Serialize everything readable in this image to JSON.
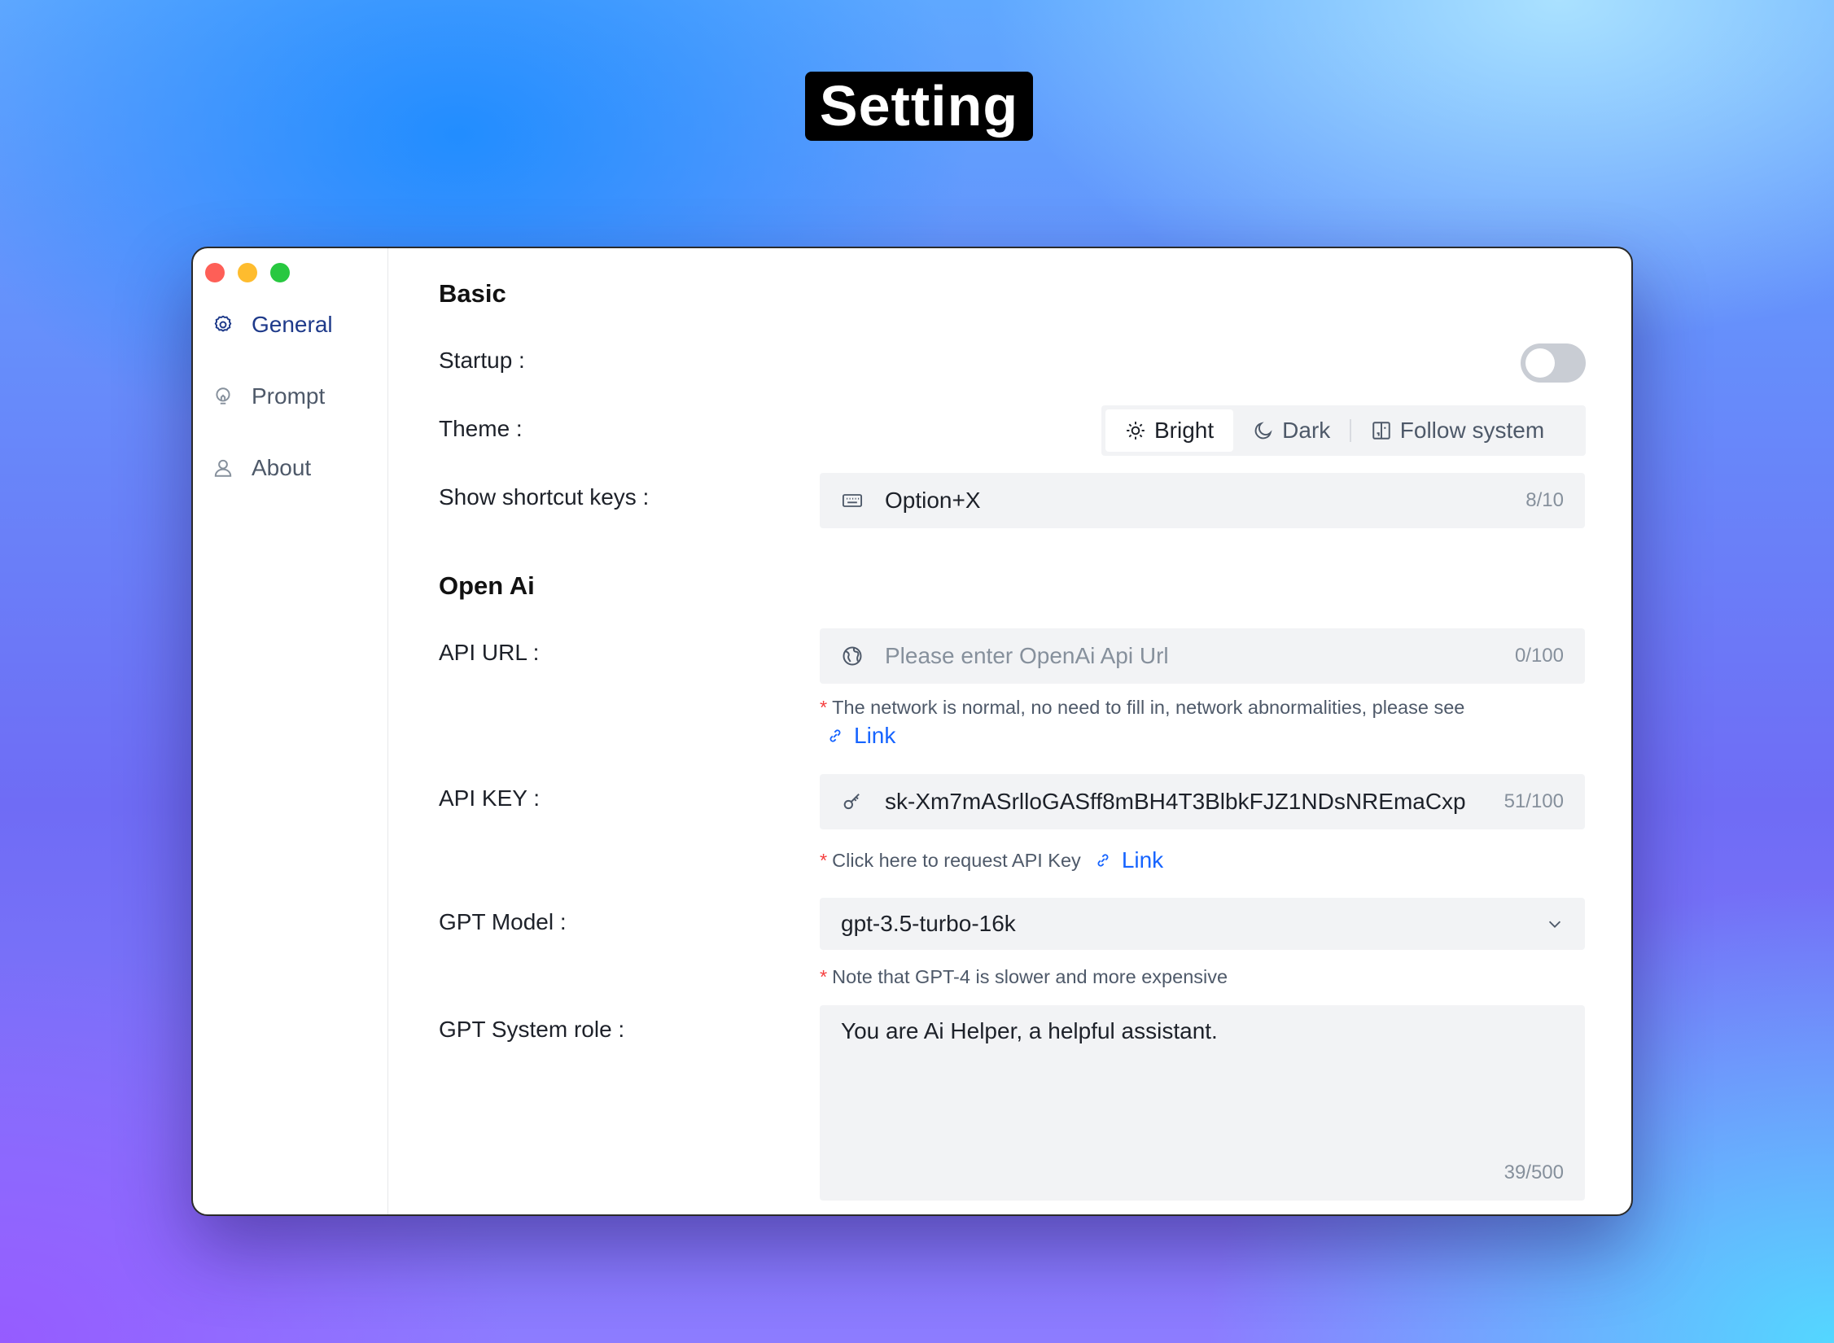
{
  "hero_title": "Setting",
  "sidebar": {
    "items": [
      {
        "label": "General",
        "icon": "gear-icon",
        "active": true
      },
      {
        "label": "Prompt",
        "icon": "bulb-icon"
      },
      {
        "label": "About",
        "icon": "user-icon"
      }
    ]
  },
  "basic": {
    "title": "Basic",
    "startup_label": "Startup :",
    "startup_enabled": false,
    "theme_label": "Theme :",
    "theme_options": [
      "Bright",
      "Dark",
      "Follow system"
    ],
    "theme_selected": "Bright",
    "shortcut_label": "Show shortcut keys :",
    "shortcut_value": "Option+X",
    "shortcut_count": "8/10"
  },
  "openai": {
    "title": "Open Ai",
    "api_url_label": "API URL :",
    "api_url_placeholder": "Please enter OpenAi Api Url",
    "api_url_count": "0/100",
    "api_url_hint": "The network is normal, no need to fill in, network abnormalities, please see",
    "api_url_link": "Link",
    "api_key_label": "API KEY :",
    "api_key_value": "sk-Xm7mASrlloGASff8mBH4T3BlbkFJZ1NDsNREmaCxp",
    "api_key_count": "51/100",
    "api_key_hint": "Click here to request API Key",
    "api_key_link": "Link",
    "model_label": "GPT Model :",
    "model_value": "gpt-3.5-turbo-16k",
    "model_hint": "Note that GPT-4 is slower and more expensive",
    "role_label": "GPT System role :",
    "role_value": "You are Ai Helper, a helpful assistant.",
    "role_count": "39/500"
  },
  "colors": {
    "accent": "#1e3a8a",
    "link": "#1664ff",
    "required_star": "#f53f3f",
    "field_bg": "#f2f3f5"
  }
}
